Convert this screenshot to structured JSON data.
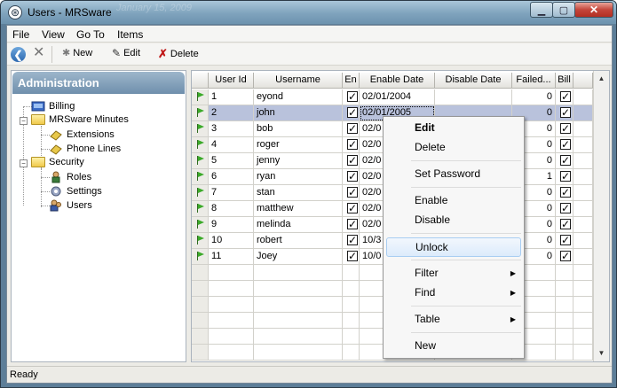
{
  "window": {
    "title": "Users - MRSware",
    "ghost_text": "January 15, 2009"
  },
  "menubar": {
    "items": [
      "File",
      "View",
      "Go To",
      "Items"
    ]
  },
  "toolbar": {
    "new_label": "New",
    "edit_label": "Edit",
    "delete_label": "Delete"
  },
  "sidebar": {
    "header": "Administration",
    "items": [
      {
        "label": "Billing",
        "icon": "billing-icon"
      },
      {
        "label": "MRSware Minutes",
        "icon": "folder-icon"
      },
      {
        "label": "Extensions",
        "icon": "extensions-icon"
      },
      {
        "label": "Phone Lines",
        "icon": "phone-lines-icon"
      },
      {
        "label": "Security",
        "icon": "folder-icon"
      },
      {
        "label": "Roles",
        "icon": "roles-icon"
      },
      {
        "label": "Settings",
        "icon": "settings-icon"
      },
      {
        "label": "Users",
        "icon": "users-icon"
      }
    ]
  },
  "grid": {
    "columns": [
      "User Id",
      "Username",
      "En",
      "Enable Date",
      "Disable Date",
      "Failed...",
      "Bill"
    ],
    "rows": [
      {
        "id": "1",
        "username": "eyond",
        "enable_date": "02/01/2004",
        "disable_date": "",
        "failed": "0"
      },
      {
        "id": "2",
        "username": "john",
        "enable_date": "02/01/2005",
        "disable_date": "",
        "failed": "0"
      },
      {
        "id": "3",
        "username": "bob",
        "enable_date": "02/0",
        "disable_date": "",
        "failed": "0"
      },
      {
        "id": "4",
        "username": "roger",
        "enable_date": "02/0",
        "disable_date": "",
        "failed": "0"
      },
      {
        "id": "5",
        "username": "jenny",
        "enable_date": "02/0",
        "disable_date": "",
        "failed": "0"
      },
      {
        "id": "6",
        "username": "ryan",
        "enable_date": "02/0",
        "disable_date": "",
        "failed": "1"
      },
      {
        "id": "7",
        "username": "stan",
        "enable_date": "02/0",
        "disable_date": "",
        "failed": "0"
      },
      {
        "id": "8",
        "username": "matthew",
        "enable_date": "02/0",
        "disable_date": "",
        "failed": "0"
      },
      {
        "id": "9",
        "username": "melinda",
        "enable_date": "02/0",
        "disable_date": "",
        "failed": "0"
      },
      {
        "id": "10",
        "username": "robert",
        "enable_date": "10/3",
        "disable_date": "",
        "failed": "0"
      },
      {
        "id": "11",
        "username": "Joey",
        "enable_date": "10/0",
        "disable_date": "",
        "failed": "0"
      }
    ],
    "selected_row": "2"
  },
  "context_menu": {
    "items": [
      "Edit",
      "Delete",
      "Set Password",
      "Enable",
      "Disable",
      "Unlock",
      "Filter",
      "Find",
      "Table",
      "New"
    ],
    "highlighted": "Unlock"
  },
  "status": {
    "text": "Ready"
  }
}
